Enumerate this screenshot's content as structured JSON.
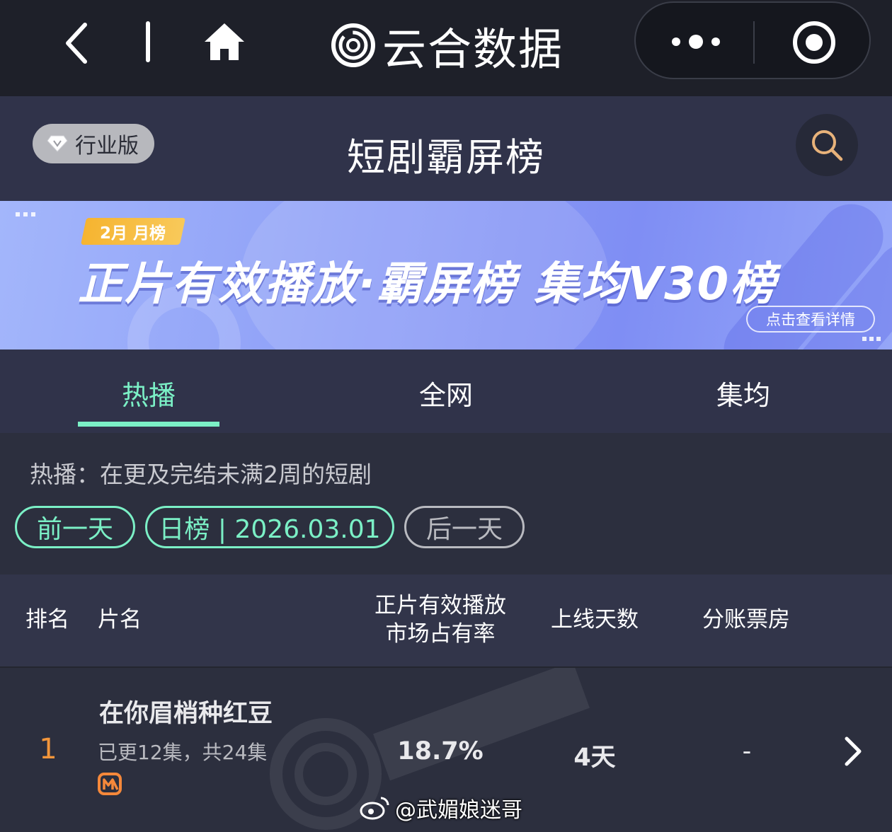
{
  "topbar": {
    "app_title": "云合数据",
    "icons": [
      "back-icon",
      "home-icon",
      "yunhe-logo-icon",
      "more-dots-icon",
      "close-target-icon"
    ]
  },
  "header": {
    "edition_label": "行业版",
    "page_title": "短剧霸屏榜",
    "icons": [
      "diamond-icon",
      "search-icon"
    ]
  },
  "banner": {
    "tag": "2月 月榜",
    "headline": "正片有效播放·霸屏榜 集均V30榜",
    "detail_button": "点击查看详情"
  },
  "tabs": [
    {
      "label": "热播",
      "active": true
    },
    {
      "label": "全网",
      "active": false
    },
    {
      "label": "集均",
      "active": false
    }
  ],
  "filter": {
    "description": "热播：在更及完结未满2周的短剧",
    "prev_day": "前一天",
    "current": "日榜 | 2026.03.01",
    "next_day": "后一天"
  },
  "table": {
    "headers": {
      "rank": "排名",
      "name": "片名",
      "share_line1": "正片有效播放",
      "share_line2": "市场占有率",
      "days": "上线天数",
      "box_office": "分账票房"
    },
    "rows": [
      {
        "rank": "1",
        "name": "在你眉梢种红豆",
        "episodes": "已更12集，共24集",
        "platform_icon": "mango-tv-icon",
        "share": "18.7%",
        "days": "4天",
        "box_office": "-"
      }
    ]
  },
  "overlay": {
    "weibo_handle": "@武媚娘迷哥"
  },
  "colors": {
    "accent": "#7bf0c6",
    "rank": "#f3963b",
    "background": "#2c2f3e",
    "topbar": "#1e2029"
  }
}
